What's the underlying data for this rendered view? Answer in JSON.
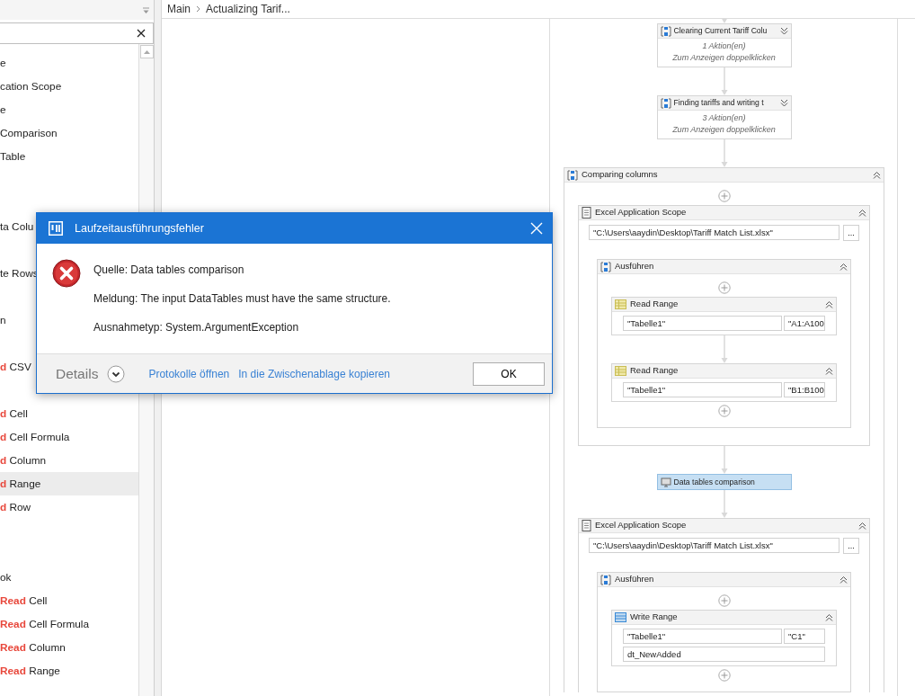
{
  "palette": {
    "rows": [
      {
        "kind": "entry",
        "text": "e",
        "selected": false
      },
      {
        "kind": "entry",
        "text": "cation Scope",
        "selected": false
      },
      {
        "kind": "entry",
        "text": "e",
        "selected": false
      },
      {
        "kind": "entry",
        "text": "Comparison",
        "selected": false
      },
      {
        "kind": "entry",
        "text": "Table",
        "selected": false
      },
      {
        "kind": "blank"
      },
      {
        "kind": "blank"
      },
      {
        "kind": "entry",
        "text": "ta Colu",
        "selected": false
      },
      {
        "kind": "blank"
      },
      {
        "kind": "entry",
        "text": "te Rows",
        "selected": false
      },
      {
        "kind": "blank"
      },
      {
        "kind": "entry",
        "text": "n",
        "selected": false
      },
      {
        "kind": "blank"
      },
      {
        "kind": "entry",
        "text": "**d** CSV",
        "selected": false
      },
      {
        "kind": "blank"
      },
      {
        "kind": "entry",
        "text": "**d** Cell",
        "selected": false
      },
      {
        "kind": "entry",
        "text": "**d** Cell Formula",
        "selected": false
      },
      {
        "kind": "entry",
        "text": "**d** Column",
        "selected": false
      },
      {
        "kind": "entry",
        "text": "**d** Range",
        "selected": true
      },
      {
        "kind": "entry",
        "text": "**d** Row",
        "selected": false
      },
      {
        "kind": "blank"
      },
      {
        "kind": "blank"
      },
      {
        "kind": "entry",
        "text": "ok",
        "selected": false
      },
      {
        "kind": "entry",
        "text": "**Read** Cell",
        "selected": false
      },
      {
        "kind": "entry",
        "text": "**Read** Cell Formula",
        "selected": false
      },
      {
        "kind": "entry",
        "text": "**Read** Column",
        "selected": false
      },
      {
        "kind": "entry",
        "text": "**Read** Range",
        "selected": false
      }
    ]
  },
  "breadcrumb": [
    "Main",
    "Actualizing Tarif..."
  ],
  "workflow": [
    {
      "kind": "sequence",
      "title": "Clearing Current Tariff Colu",
      "expanded": false,
      "selected": false,
      "lines": [
        "1 Aktion(en)",
        "Zum Anzeigen doppelklicken"
      ]
    },
    {
      "kind": "sequence",
      "title": "Finding tariffs and writing t",
      "expanded": false,
      "selected": false,
      "lines": [
        "3 Aktion(en)",
        "Zum Anzeigen doppelklicken"
      ]
    },
    {
      "kind": "sequence",
      "title": "Comparing columns",
      "expanded": true,
      "selected": false,
      "cut": true,
      "children": [
        {
          "kind": "scope",
          "title": "Excel Application Scope",
          "expanded": true,
          "selected": false,
          "path": "\"C:\\Users\\aaydin\\Desktop\\Tariff Match List.xlsx\"",
          "browse": "...",
          "children": [
            {
              "kind": "sequence",
              "title": "Ausführen",
              "expanded": true,
              "selected": false,
              "children": [
                {
                  "kind": "reader",
                  "title": "Read Range",
                  "expanded": true,
                  "selected": false,
                  "fields": [
                    [
                      "\"Tabelle1\"",
                      "\"A1:A100"
                    ]
                  ]
                },
                {
                  "kind": "reader",
                  "title": "Read Range",
                  "expanded": true,
                  "selected": false,
                  "fields": [
                    [
                      "\"Tabelle1\"",
                      "\"B1:B100"
                    ]
                  ]
                }
              ]
            }
          ]
        },
        {
          "kind": "invoke",
          "title": "Data tables comparison",
          "selected": true
        },
        {
          "kind": "scope",
          "title": "Excel Application Scope",
          "expanded": true,
          "selected": false,
          "cut": true,
          "path": "\"C:\\Users\\aaydin\\Desktop\\Tariff Match List.xlsx\"",
          "browse": "...",
          "children": [
            {
              "kind": "sequence",
              "title": "Ausführen",
              "expanded": true,
              "selected": false,
              "children": [
                {
                  "kind": "writer",
                  "title": "Write Range",
                  "expanded": true,
                  "selected": false,
                  "fields": [
                    [
                      "\"Tabelle1\"",
                      "\"C1\""
                    ],
                    [
                      "dt_NewAdded"
                    ]
                  ]
                }
              ]
            }
          ]
        }
      ]
    }
  ],
  "dialog": {
    "title": "Laufzeitausführungsfehler",
    "messages": [
      "Quelle: Data tables comparison",
      "Meldung: The input DataTables must have the same structure.",
      "Ausnahmetyp: System.ArgumentException"
    ],
    "details": "Details",
    "links": [
      "Protokolle öffnen",
      "In die Zwischenablage kopieren"
    ],
    "ok": "OK"
  }
}
